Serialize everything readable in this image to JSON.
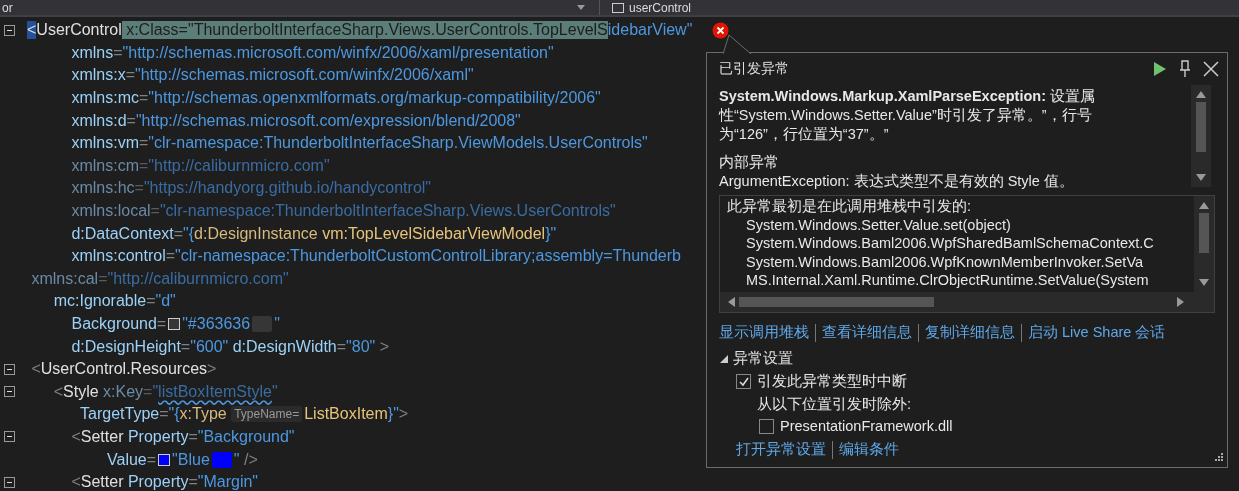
{
  "top_bar": {
    "left_text": "or",
    "right_dropdown": "userControl"
  },
  "code_lines": [
    {
      "foldable": true,
      "error": true,
      "tokens": [
        {
          "kind": "punct",
          "text": "<",
          "match": true
        },
        {
          "kind": "element",
          "text": "UserControl"
        },
        {
          "kind": "attr",
          "text": " x:Class=\"ThunderboltInterfaceSharp.Views.UserControls.TopLevelS",
          "highlight": true
        },
        {
          "kind": "string",
          "text": "idebarView\""
        }
      ]
    },
    {
      "foldable": false,
      "tokens": [
        {
          "kind": "attr",
          "text": "          xmlns"
        },
        {
          "kind": "punct",
          "text": "="
        },
        {
          "kind": "string",
          "text": "\"http://schemas.microsoft.com/winfx/2006/xaml/presentation\""
        }
      ]
    },
    {
      "foldable": false,
      "tokens": [
        {
          "kind": "attr",
          "text": "          xmlns:x"
        },
        {
          "kind": "punct",
          "text": "="
        },
        {
          "kind": "string",
          "text": "\"http://schemas.microsoft.com/winfx/2006/xaml\""
        }
      ]
    },
    {
      "foldable": false,
      "tokens": [
        {
          "kind": "attr",
          "text": "          xmlns:mc"
        },
        {
          "kind": "punct",
          "text": "="
        },
        {
          "kind": "string",
          "text": "\"http://schemas.openxmlformats.org/markup-compatibility/2006\""
        }
      ]
    },
    {
      "foldable": false,
      "tokens": [
        {
          "kind": "attr",
          "text": "          xmlns:d"
        },
        {
          "kind": "punct",
          "text": "="
        },
        {
          "kind": "string",
          "text": "\"http://schemas.microsoft.com/expression/blend/2008\""
        }
      ]
    },
    {
      "foldable": false,
      "tokens": [
        {
          "kind": "attr",
          "text": "          xmlns:vm"
        },
        {
          "kind": "punct",
          "text": "="
        },
        {
          "kind": "string",
          "text": "\"clr-namespace:ThunderboltInterfaceSharp.ViewModels.UserControls\""
        }
      ]
    },
    {
      "foldable": false,
      "tokens": [
        {
          "kind": "dim-attr",
          "text": "          xmlns:cm"
        },
        {
          "kind": "dim-punct",
          "text": "="
        },
        {
          "kind": "dim-string",
          "text": "\"http://caliburnmicro.com\""
        }
      ]
    },
    {
      "foldable": false,
      "tokens": [
        {
          "kind": "dim-attr",
          "text": "          xmlns:hc"
        },
        {
          "kind": "dim-punct",
          "text": "="
        },
        {
          "kind": "dim-string",
          "text": "\"https://handyorg.github.io/handycontrol\""
        }
      ]
    },
    {
      "foldable": false,
      "tokens": [
        {
          "kind": "dim-attr",
          "text": "          xmlns:local"
        },
        {
          "kind": "dim-punct",
          "text": "="
        },
        {
          "kind": "dim-string",
          "text": "\"clr-namespace:ThunderboltInterfaceSharp.Views.UserControls\""
        }
      ]
    },
    {
      "foldable": false,
      "tokens": [
        {
          "kind": "attr",
          "text": "          d:DataContext"
        },
        {
          "kind": "punct",
          "text": "="
        },
        {
          "kind": "string",
          "text": "\"{"
        },
        {
          "kind": "ext",
          "text": "d:DesignInstance "
        },
        {
          "kind": "ext-arg",
          "text": "vm:TopLevelSidebarViewModel"
        },
        {
          "kind": "string",
          "text": "}\""
        }
      ]
    },
    {
      "foldable": false,
      "tokens": [
        {
          "kind": "attr",
          "text": "          xmlns:control"
        },
        {
          "kind": "punct",
          "text": "="
        },
        {
          "kind": "string",
          "text": "\"clr-namespace:ThunderboltCustomControlLibrary;assembly=Thunderb"
        }
      ]
    },
    {
      "foldable": false,
      "tokens": [
        {
          "kind": "dim-attr",
          "text": " xmlns:cal"
        },
        {
          "kind": "dim-punct",
          "text": "="
        },
        {
          "kind": "dim-string",
          "text": "\"http://caliburnmicro.com\""
        }
      ]
    },
    {
      "foldable": false,
      "tokens": [
        {
          "kind": "attr",
          "text": "      mc:Ignorable"
        },
        {
          "kind": "punct",
          "text": "="
        },
        {
          "kind": "string",
          "text": "\"d\""
        }
      ]
    },
    {
      "foldable": false,
      "tokens": [
        {
          "kind": "attr",
          "text": "          Background"
        },
        {
          "kind": "punct",
          "text": "="
        },
        {
          "kind": "swatch-icon",
          "color": "#363636"
        },
        {
          "kind": "string",
          "text": "\"#363636"
        },
        {
          "kind": "swatch-block",
          "color": "#363636"
        },
        {
          "kind": "string",
          "text": "\""
        }
      ]
    },
    {
      "foldable": false,
      "tokens": [
        {
          "kind": "attr",
          "text": "          d:DesignHeight"
        },
        {
          "kind": "punct",
          "text": "="
        },
        {
          "kind": "string",
          "text": "\"600\""
        },
        {
          "kind": "attr",
          "text": " d:DesignWidth"
        },
        {
          "kind": "punct",
          "text": "="
        },
        {
          "kind": "string",
          "text": "\"80\""
        },
        {
          "kind": "punct",
          "text": " >"
        }
      ]
    },
    {
      "foldable": true,
      "tokens": [
        {
          "kind": "punct",
          "text": " <"
        },
        {
          "kind": "element",
          "text": "UserControl.Resources"
        },
        {
          "kind": "punct",
          "text": ">"
        }
      ]
    },
    {
      "foldable": true,
      "tokens": [
        {
          "kind": "punct",
          "text": "      <"
        },
        {
          "kind": "element",
          "text": "Style"
        },
        {
          "kind": "dim-attr",
          "text": " x:Key"
        },
        {
          "kind": "dim-punct",
          "text": "="
        },
        {
          "kind": "dim-string",
          "text": "\""
        },
        {
          "kind": "dim-string",
          "text": "listBoxItemStyle",
          "squiggle": true
        },
        {
          "kind": "dim-string",
          "text": "\""
        }
      ]
    },
    {
      "foldable": false,
      "tokens": [
        {
          "kind": "attr",
          "text": "            TargetType"
        },
        {
          "kind": "punct",
          "text": "="
        },
        {
          "kind": "string",
          "text": "\"{"
        },
        {
          "kind": "ext",
          "text": "x:Type "
        },
        {
          "kind": "hint",
          "text": "TypeName="
        },
        {
          "kind": "ext-arg",
          "text": "ListBoxItem"
        },
        {
          "kind": "string",
          "text": "}\""
        },
        {
          "kind": "punct",
          "text": ">"
        }
      ]
    },
    {
      "foldable": true,
      "tokens": [
        {
          "kind": "punct",
          "text": "          <"
        },
        {
          "kind": "element",
          "text": "Setter"
        },
        {
          "kind": "attr",
          "text": " Property"
        },
        {
          "kind": "punct",
          "text": "="
        },
        {
          "kind": "string",
          "text": "\"Background\""
        }
      ]
    },
    {
      "foldable": false,
      "tokens": [
        {
          "kind": "attr",
          "text": "                  Value"
        },
        {
          "kind": "punct",
          "text": "="
        },
        {
          "kind": "swatch-icon",
          "color": "#0000ff"
        },
        {
          "kind": "string",
          "text": "\"Blue"
        },
        {
          "kind": "swatch-block",
          "color": "#0000ff"
        },
        {
          "kind": "string",
          "text": "\""
        },
        {
          "kind": "punct",
          "text": " />"
        }
      ]
    },
    {
      "foldable": true,
      "tokens": [
        {
          "kind": "punct",
          "text": "          <"
        },
        {
          "kind": "element",
          "text": "Setter"
        },
        {
          "kind": "attr",
          "text": " Property"
        },
        {
          "kind": "punct",
          "text": "="
        },
        {
          "kind": "string",
          "text": "\"Margin\""
        }
      ]
    }
  ],
  "exception_popup": {
    "title": "已引发异常",
    "message": [
      "**System.Windows.Markup.XamlParseException:** 设置属",
      "性“System.Windows.Setter.Value”时引发了异常。”，行号",
      "为“126”，行位置为“37”。”"
    ],
    "inner_heading": "内部异常",
    "inner_message": "ArgumentException: 表达式类型不是有效的 Style 值。",
    "stack_heading": "此异常最初是在此调用堆栈中引发的:",
    "stack": [
      "System.Windows.Setter.Value.set(object)",
      "System.Windows.Baml2006.WpfSharedBamlSchemaContext.C",
      "System.Windows.Baml2006.WpfKnownMemberInvoker.SetVa",
      "MS.Internal.Xaml.Runtime.ClrObjectRuntime.SetValue(System"
    ],
    "links": [
      "显示调用堆栈",
      "查看详细信息",
      "复制详细信息",
      "启动 Live Share 会话"
    ],
    "settings": {
      "heading": "异常设置",
      "expanded": true,
      "break_option": {
        "label": "引发此异常类型时中断",
        "checked": true
      },
      "except_label": "从以下位置引发时除外:",
      "module_option": {
        "label": "PresentationFramework.dll",
        "checked": false
      }
    },
    "bottom_links": [
      "打开异常设置",
      "编辑条件"
    ]
  }
}
